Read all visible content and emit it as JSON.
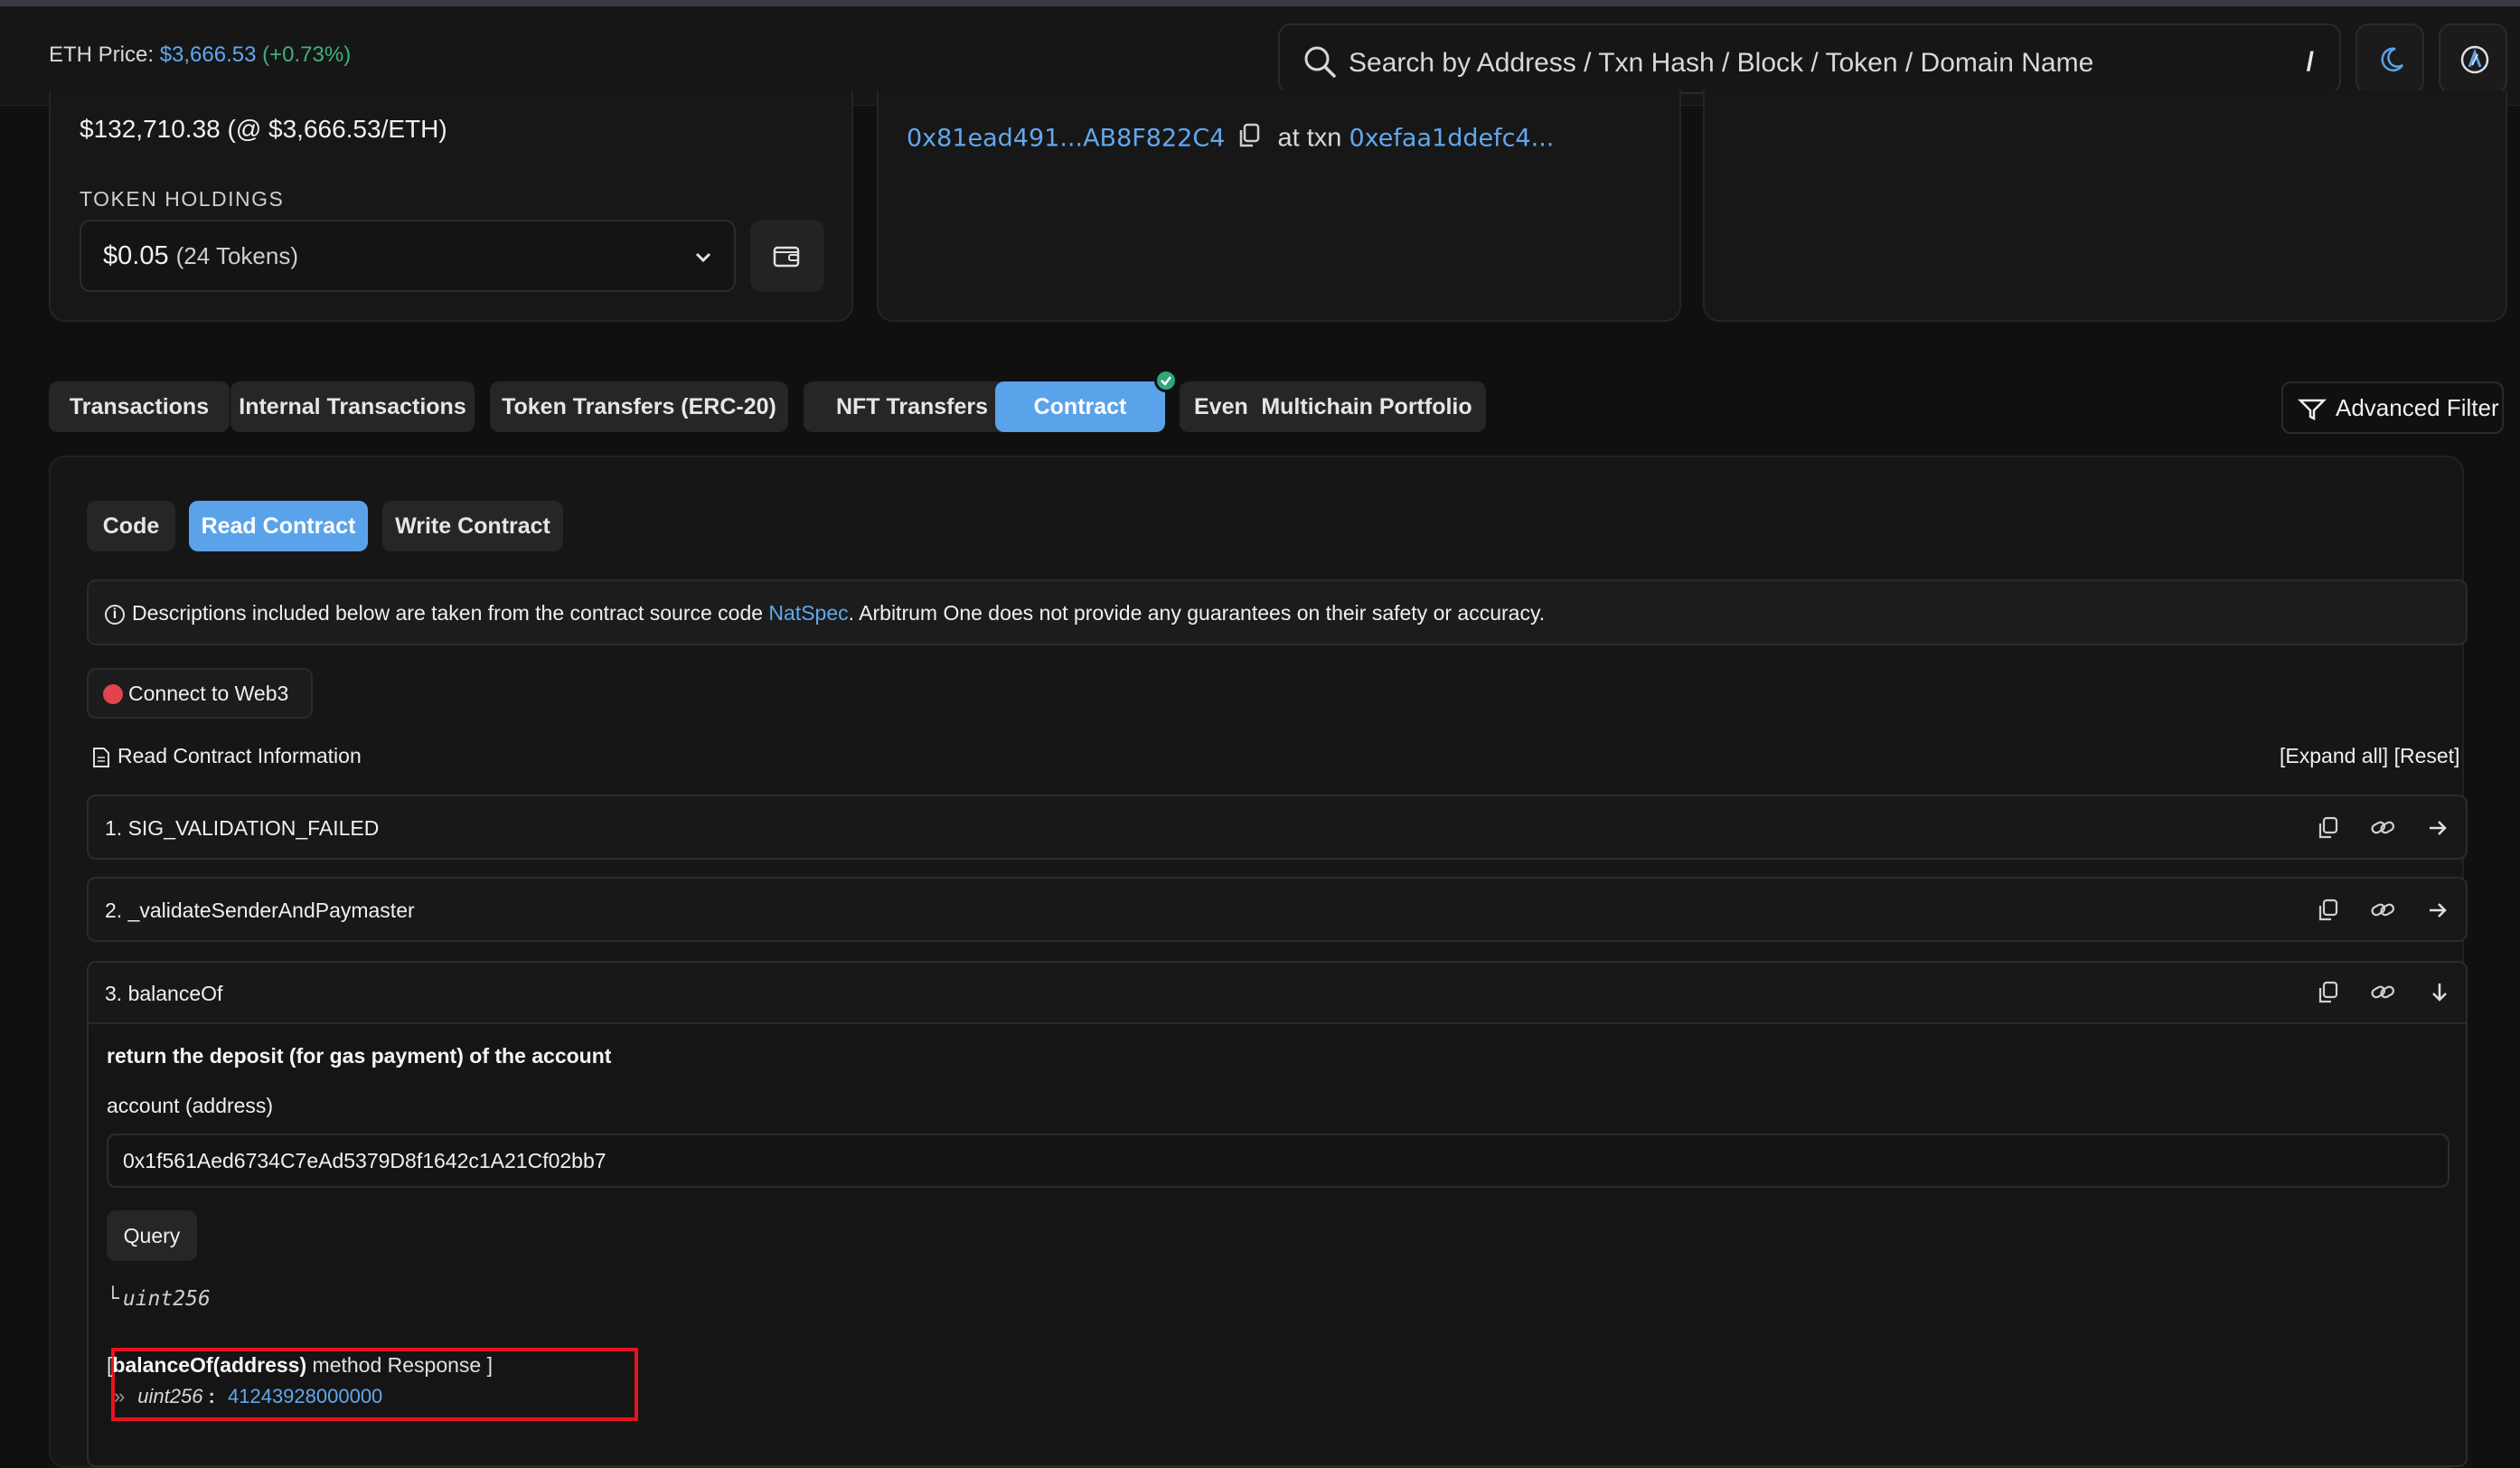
{
  "header": {
    "eth_label": "ETH Price: ",
    "eth_price": "$3,666.53",
    "eth_change": "(+0.73%)",
    "search_placeholder": "Search by Address / Txn Hash / Block / Token / Domain Name",
    "search_shortcut": "/"
  },
  "overview": {
    "eth_value": "$132,710.38 (@ $3,666.53/ETH)",
    "token_holdings_label": "TOKEN HOLDINGS",
    "token_holdings_amount": "$0.05",
    "token_holdings_count": "(24 Tokens)",
    "creator_address": "0x81ead491...AB8F822C4",
    "creator_at_txn": "at txn",
    "creator_txn": "0xefaa1ddefc4..."
  },
  "tabs": [
    {
      "label": "Transactions"
    },
    {
      "label": "Internal Transactions"
    },
    {
      "label": "Token Transfers (ERC-20)"
    },
    {
      "label": "NFT Transfers"
    },
    {
      "label": "Contract"
    },
    {
      "label": "Events"
    },
    {
      "label": "Multichain Portfolio"
    }
  ],
  "advanced_filter": "Advanced Filter",
  "subtabs": [
    {
      "label": "Code"
    },
    {
      "label": "Read Contract"
    },
    {
      "label": "Write Contract"
    }
  ],
  "notice": {
    "text_before": "Descriptions included below are taken from the contract source code ",
    "link": "NatSpec",
    "text_after": ". Arbitrum One does not provide any guarantees on their safety or accuracy."
  },
  "connect_label": "Connect to Web3",
  "read_info_label": "Read Contract Information",
  "expand_reset": "[Expand all]  [Reset]",
  "functions": [
    {
      "name": "1. SIG_VALIDATION_FAILED"
    },
    {
      "name": "2. _validateSenderAndPaymaster"
    },
    {
      "name": "3. balanceOf"
    }
  ],
  "balance_of": {
    "description": "return the deposit (for gas payment) of the account",
    "arg_label": "account (address)",
    "arg_value": "0x1f561Aed6734C7eAd5379D8f1642c1A21Cf02bb7",
    "query_label": "Query",
    "output_type": "uint256",
    "response_bracket_open": "[",
    "response_method": "balanceOf(address)",
    "response_suffix": " method Response ]",
    "response_type": "uint256",
    "response_colon": " : ",
    "response_value": "41243928000000"
  },
  "colors": {
    "accent": "#5aa3eb",
    "link": "#61a8ee",
    "positive": "#3bb27a",
    "highlight_box": "#e8121e",
    "web3_dot": "#e0444c"
  }
}
